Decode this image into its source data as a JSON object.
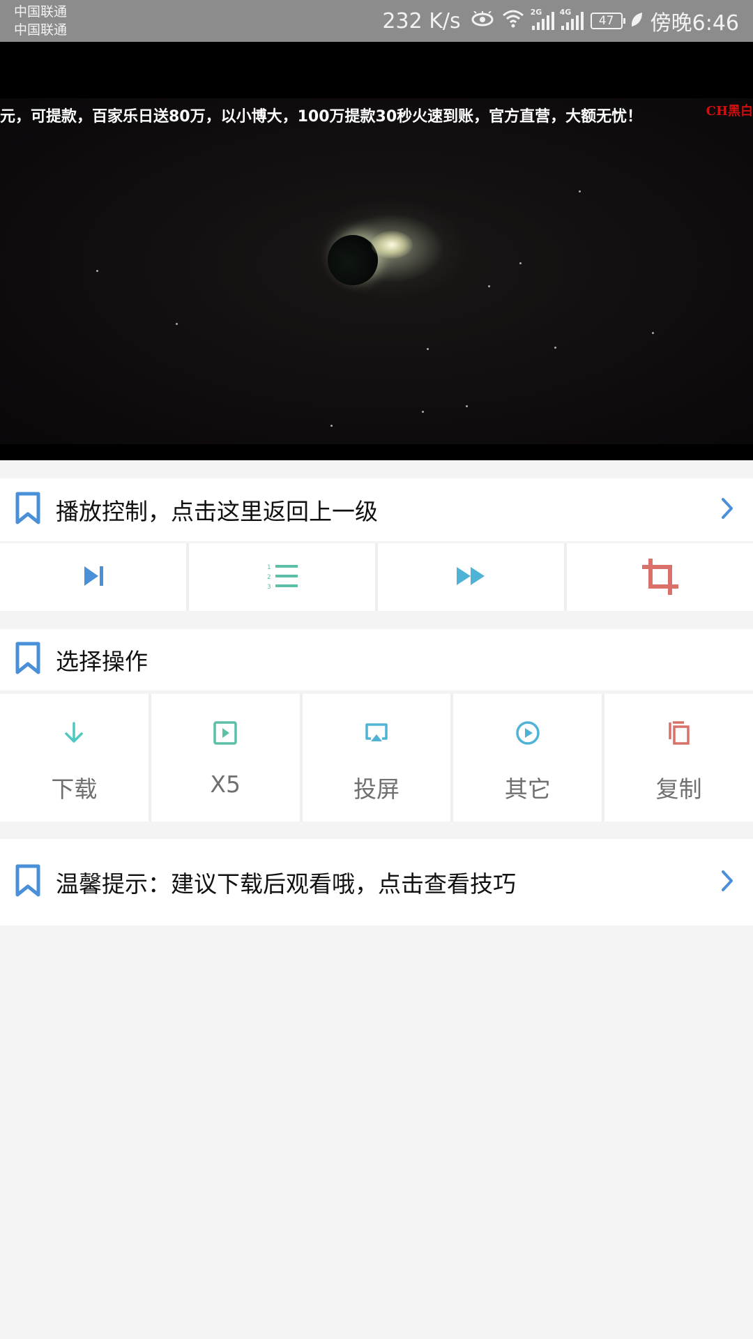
{
  "status_bar": {
    "carrier1": "中国联通",
    "carrier2": "中国联通",
    "network_speed": "232 K/s",
    "sig1_tag": "2G",
    "sig2_tag": "4G",
    "battery": "47",
    "time": "傍晚6:46"
  },
  "video": {
    "marquee": "元，可提款，百家乐日送80万，以小博大，100万提款30秒火速到账，官方直营，大额无忧！",
    "watermark": "CH黑白"
  },
  "playback_control": {
    "title": "播放控制，点击这里返回上一级",
    "buttons": [
      {
        "icon": "skip-next-icon",
        "color": "#4a90d9"
      },
      {
        "icon": "playlist-icon",
        "color": "#5cc0a8"
      },
      {
        "icon": "fast-forward-icon",
        "color": "#4fb3d6"
      },
      {
        "icon": "crop-icon",
        "color": "#d9706a"
      }
    ]
  },
  "select_operation": {
    "title": "选择操作",
    "items": [
      {
        "label": "下载",
        "icon": "download-icon",
        "color": "#4fc9c0"
      },
      {
        "label": "X5",
        "icon": "play-square-icon",
        "color": "#5cc0a8"
      },
      {
        "label": "投屏",
        "icon": "cast-icon",
        "color": "#4fb3d6"
      },
      {
        "label": "其它",
        "icon": "play-circle-icon",
        "color": "#4fb3d6"
      },
      {
        "label": "复制",
        "icon": "copy-icon",
        "color": "#d9706a"
      }
    ]
  },
  "tip": {
    "title": "温馨提示：建议下载后观看哦，点击查看技巧"
  },
  "colors": {
    "accent": "#4a90d9",
    "background": "#f4f4f4"
  }
}
